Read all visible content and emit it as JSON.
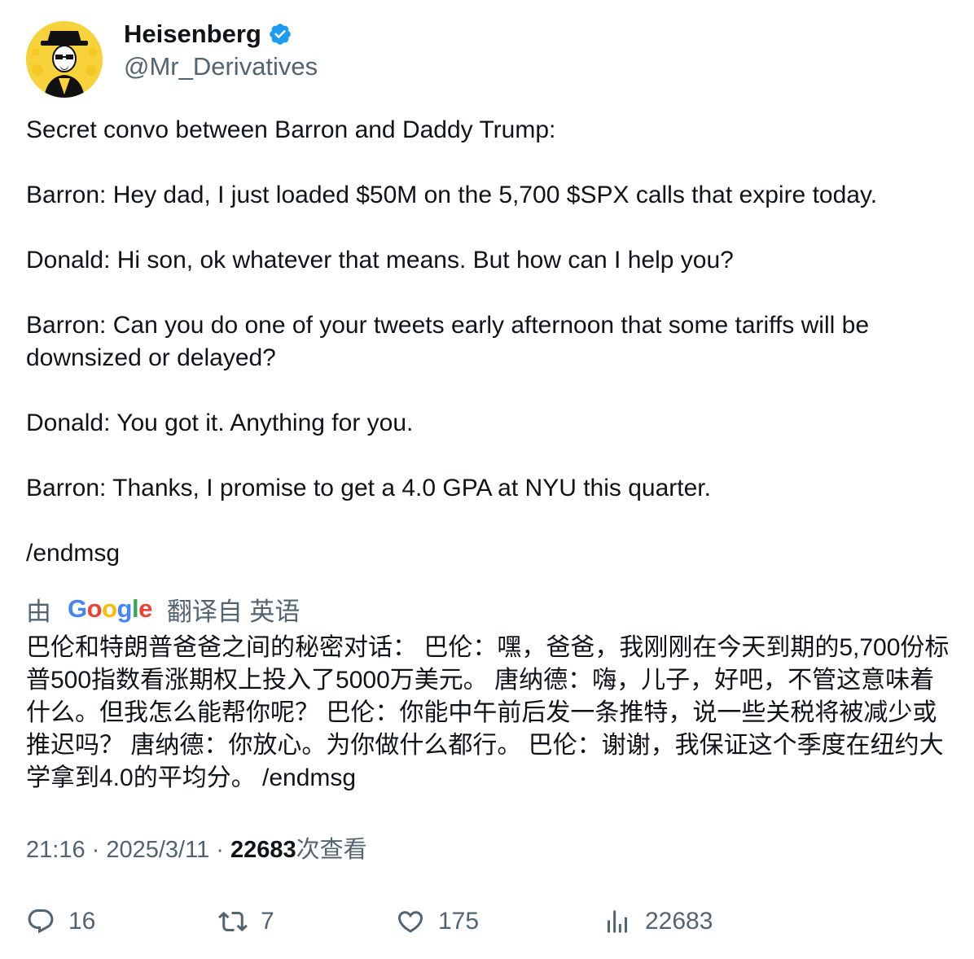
{
  "author": {
    "display_name": "Heisenberg",
    "handle": "@Mr_Derivatives",
    "verified_icon": "verified-badge-icon",
    "avatar_icon": "heisenberg-avatar",
    "avatar_bg": "#f7d23a"
  },
  "tweet": {
    "lines": [
      "Secret convo between Barron and Daddy Trump:",
      "",
      "Barron: Hey dad, I just loaded $50M on the 5,700 $SPX calls that expire today.",
      "",
      "Donald: Hi son, ok whatever that means. But how can I help you?",
      "",
      "Barron: Can you do one of your tweets early afternoon that some tariffs will be downsized or delayed?",
      "",
      "Donald: You got it. Anything for you.",
      "",
      "Barron: Thanks, I promise to get a 4.0 GPA at NYU this quarter.",
      "",
      "/endmsg"
    ]
  },
  "translation": {
    "prefix": "由",
    "provider": "Google",
    "suffix": "翻译自 英语",
    "text": "巴伦和特朗普爸爸之间的秘密对话： 巴伦：嘿，爸爸，我刚刚在今天到期的5,700份标普500指数看涨期权上投入了5000万美元。 唐纳德：嗨，儿子，好吧，不管这意味着什么。但我怎么能帮你呢？ 巴伦：你能中午前后发一条推特，说一些关税将被减少或推迟吗？ 唐纳德：你放心。为你做什么都行。 巴伦：谢谢，我保证这个季度在纽约大学拿到4.0的平均分。 /endmsg"
  },
  "meta": {
    "time": "21:16",
    "sep1": " · ",
    "date": "2025/3/11",
    "sep2": " · ",
    "views": "22683",
    "views_label": "次查看"
  },
  "actions": {
    "replies": "16",
    "retweets": "7",
    "likes": "175",
    "views": "22683"
  },
  "colors": {
    "text": "#0f1419",
    "secondary": "#536471",
    "verified": "#1d9bf0"
  }
}
